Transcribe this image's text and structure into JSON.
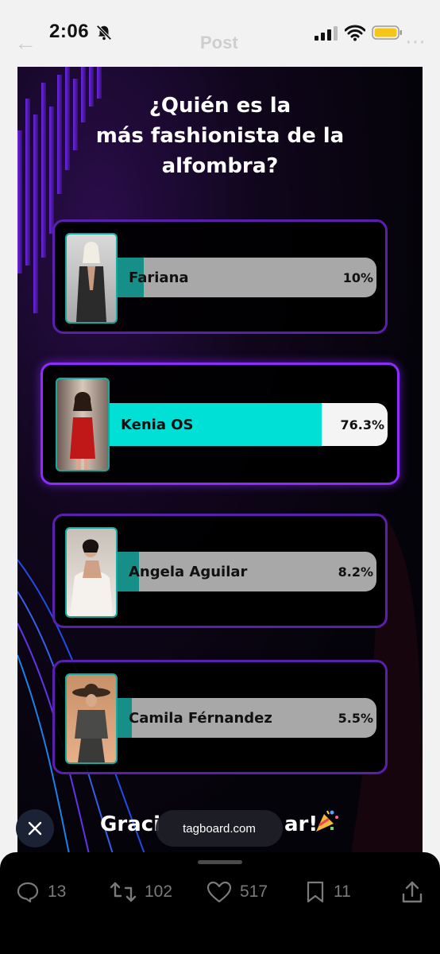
{
  "status_bar": {
    "time": "2:06",
    "faded_title": "Post"
  },
  "poll": {
    "title_lines": [
      "¿Quién es la",
      "más fashionista de la",
      "alfombra?"
    ],
    "options": [
      {
        "name": "Fariana",
        "percent_label": "10%",
        "percent": 10,
        "selected": false
      },
      {
        "name": "Kenia OS",
        "percent_label": "76.3%",
        "percent": 76.3,
        "selected": true
      },
      {
        "name": "Angela Aguilar",
        "percent_label": "8.2%",
        "percent": 8.2,
        "selected": false
      },
      {
        "name": "Camila Férnandez",
        "percent_label": "5.5%",
        "percent": 5.5,
        "selected": false
      }
    ],
    "thanks_left": "Graci",
    "thanks_right": "ar!"
  },
  "source_pill": "tagboard.com",
  "actions": {
    "replies": "13",
    "reposts": "102",
    "likes": "517",
    "bookmarks": "11"
  },
  "colors": {
    "accent_purple": "#8c2cff",
    "bar_teal": "#00e0d6",
    "bar_teal_dark": "#158f88"
  }
}
